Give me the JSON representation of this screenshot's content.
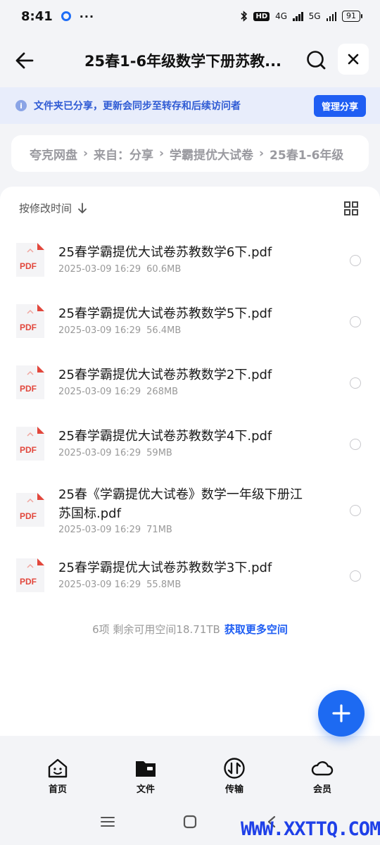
{
  "status_bar": {
    "time": "8:41",
    "dots": "···",
    "hd": "HD",
    "net1": "4G",
    "net2": "5G",
    "battery": "91"
  },
  "header": {
    "title": "25春1-6年级数学下册苏教..."
  },
  "banner": {
    "text": "文件夹已分享，更新会同步至转存和后续访问者",
    "manage_label": "管理分享"
  },
  "breadcrumb": [
    "夸克网盘",
    "来自：分享",
    "学霸提优大试卷",
    "25春1-6年级"
  ],
  "sort": {
    "label": "按修改时间"
  },
  "files": [
    {
      "name": "25春学霸提优大试卷苏教数学6下.pdf",
      "date": "2025-03-09 16:29",
      "size": "60.6MB"
    },
    {
      "name": "25春学霸提优大试卷苏教数学5下.pdf",
      "date": "2025-03-09 16:29",
      "size": "56.4MB"
    },
    {
      "name": "25春学霸提优大试卷苏教数学2下.pdf",
      "date": "2025-03-09 16:29",
      "size": "268MB"
    },
    {
      "name": "25春学霸提优大试卷苏教数学4下.pdf",
      "date": "2025-03-09 16:29",
      "size": "59MB"
    },
    {
      "name": "25春《学霸提优大试卷》数学一年级下册江苏国标.pdf",
      "date": "2025-03-09 16:29",
      "size": "71MB"
    },
    {
      "name": "25春学霸提优大试卷苏教数学3下.pdf",
      "date": "2025-03-09 16:29",
      "size": "55.8MB"
    }
  ],
  "pdf_label": "PDF",
  "footer": {
    "summary": "6项  剩余可用空间18.71TB",
    "more_space": "获取更多空间"
  },
  "nav": [
    {
      "label": "首页",
      "icon": "home-face-icon"
    },
    {
      "label": "文件",
      "icon": "folder-icon"
    },
    {
      "label": "传输",
      "icon": "transfer-icon"
    },
    {
      "label": "会员",
      "icon": "cloud-icon"
    }
  ],
  "watermark": "WWW.XXTTQ.COM",
  "colors": {
    "accent": "#1f5ef3",
    "pdf_red": "#e2473c"
  }
}
